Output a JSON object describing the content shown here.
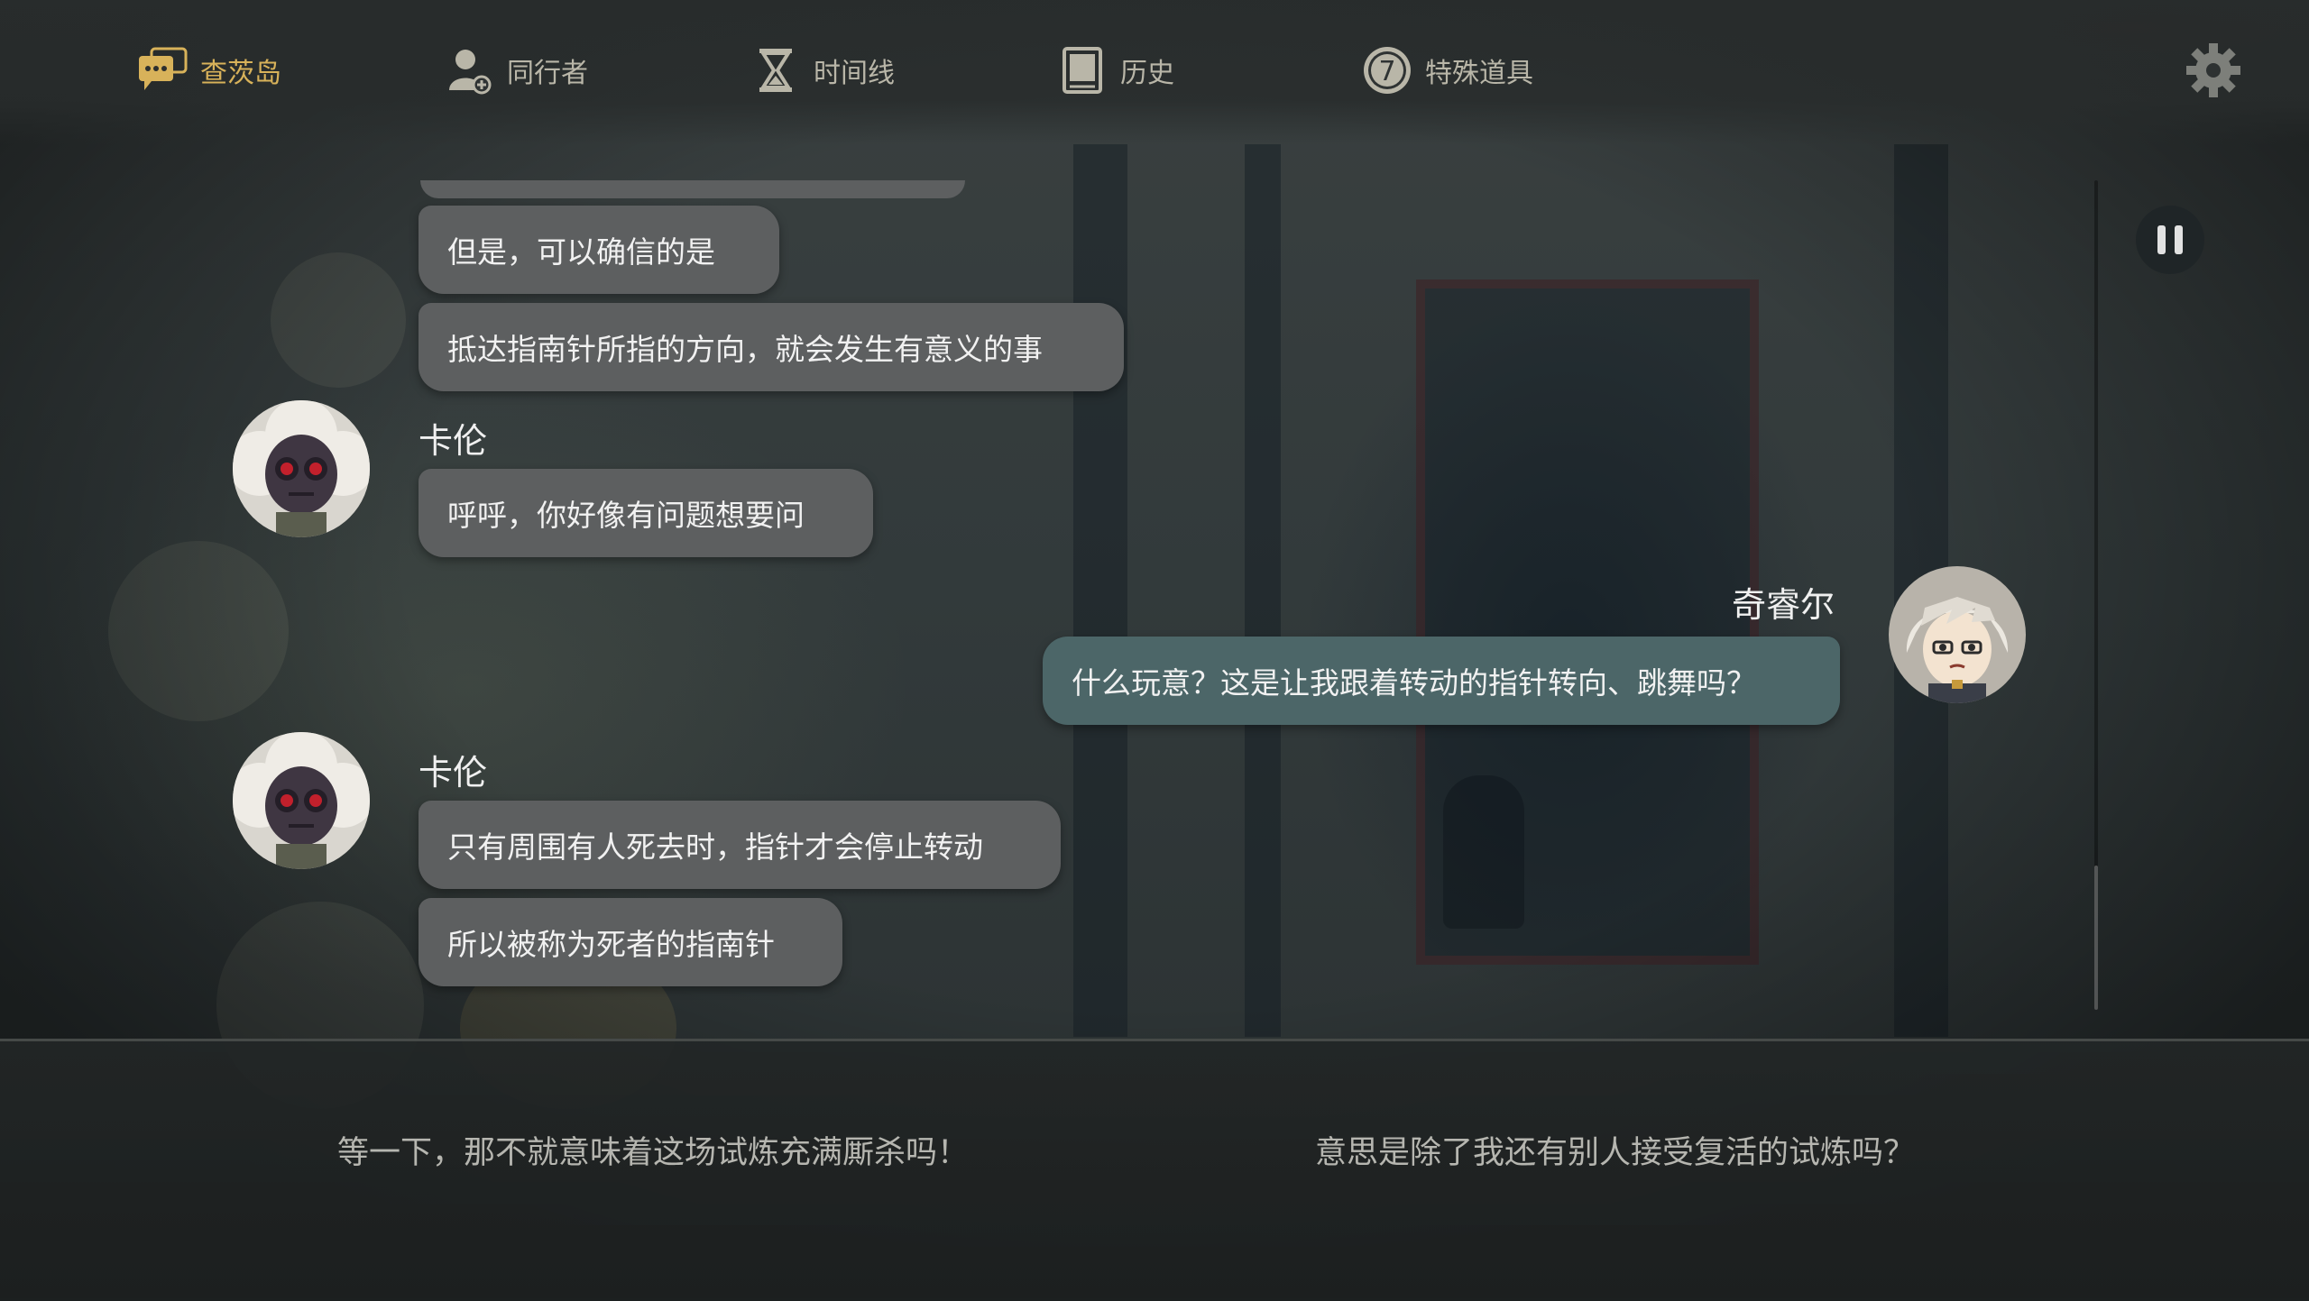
{
  "nav": {
    "tabs": [
      {
        "label": "查茨岛",
        "icon": "chat-bubbles-icon"
      },
      {
        "label": "同行者",
        "icon": "companion-icon"
      },
      {
        "label": "时间线",
        "icon": "hourglass-icon"
      },
      {
        "label": "历史",
        "icon": "book-icon"
      },
      {
        "label": "特殊道具",
        "icon": "item-7-icon"
      }
    ],
    "item_badge": "7",
    "settings_icon": "gear-icon"
  },
  "chat": {
    "messages": [
      {
        "text": "但是，可以确信的是"
      },
      {
        "text": "抵达指南针所指的方向，就会发生有意义的事"
      },
      {
        "speaker": "卡伦",
        "text": "呼呼，你好像有问题想要问"
      },
      {
        "speaker": "奇睿尔",
        "text": "什么玩意？这是让我跟着转动的指针转向、跳舞吗？"
      },
      {
        "speaker": "卡伦",
        "text": "只有周围有人死去时，指针才会停止转动"
      },
      {
        "text": "所以被称为死者的指南针"
      }
    ]
  },
  "choices": [
    {
      "text": "等一下，那不就意味着这场试炼充满厮杀吗！"
    },
    {
      "text": "意思是除了我还有别人接受复活的试炼吗？"
    }
  ],
  "controls": {
    "pause_icon": "pause-icon"
  },
  "colors": {
    "active_tab": "#d8b25a",
    "inactive_tab": "#b9b6a8",
    "left_bubble": "#5d5f60",
    "right_bubble": "#4c6668"
  }
}
